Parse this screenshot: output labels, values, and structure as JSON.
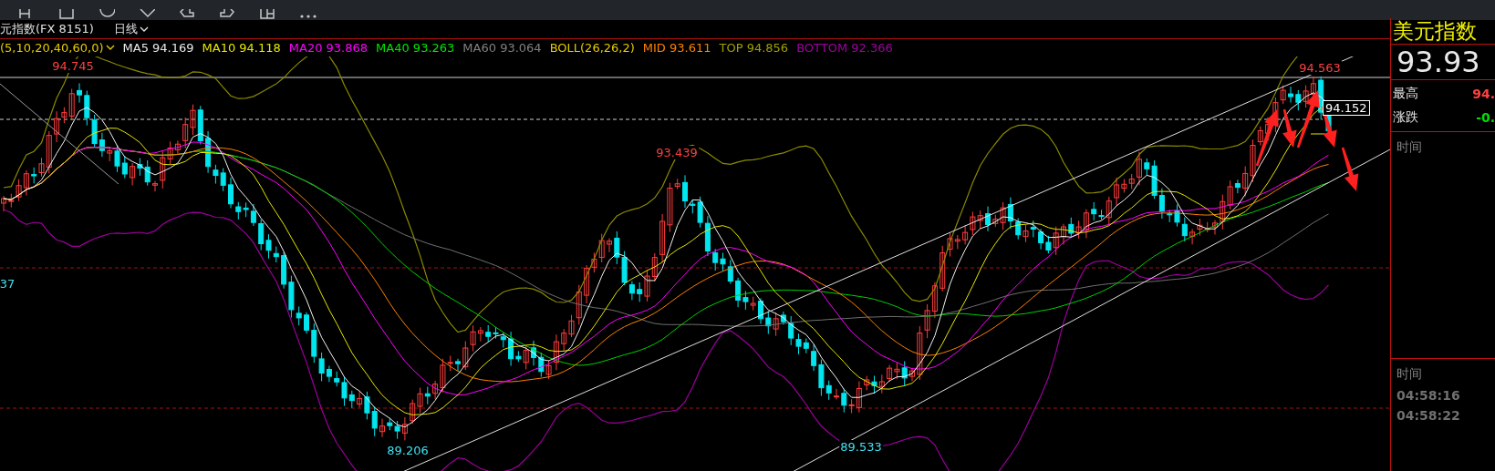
{
  "chart_header": {
    "symbol": "元指数(FX 8151)",
    "period": "日线",
    "indicator_params": "(5,10,20,40,60,0)"
  },
  "indicators": [
    {
      "label": "MA5 94.169",
      "color": "#e8e8e8"
    },
    {
      "label": "MA10 94.118",
      "color": "#e6e600"
    },
    {
      "label": "MA20 93.868",
      "color": "#ff00ff"
    },
    {
      "label": "MA40 93.263",
      "color": "#00e600"
    },
    {
      "label": "MA60 93.064",
      "color": "#808080"
    },
    {
      "label": "BOLL(26,26,2)",
      "color": "#e6c800"
    },
    {
      "label": "MID 93.611",
      "color": "#ff8000"
    },
    {
      "label": "TOP 94.856",
      "color": "#a0a000"
    },
    {
      "label": "BOTTOM 92.366",
      "color": "#a000a0"
    }
  ],
  "price_labels": [
    {
      "text": "94.745",
      "kind": "high"
    },
    {
      "text": "93.439",
      "kind": "high"
    },
    {
      "text": "94.563",
      "kind": "high"
    },
    {
      "text": "89.206",
      "kind": "low"
    },
    {
      "text": "89.533",
      "kind": "low"
    }
  ],
  "axis_label": "37",
  "current_price_tag": "94.152",
  "quote_panel": {
    "name": "美元指数",
    "price": "93.93",
    "rows": [
      {
        "label": "最高",
        "value": "94.",
        "color": "#ff4040"
      },
      {
        "label": "涨跌",
        "value": "-0.",
        "color": "#00e000"
      }
    ]
  },
  "time_sections": [
    {
      "label": "时间"
    },
    {
      "label": "时间",
      "times": [
        "04:58:16",
        "04:58:22"
      ]
    }
  ]
}
